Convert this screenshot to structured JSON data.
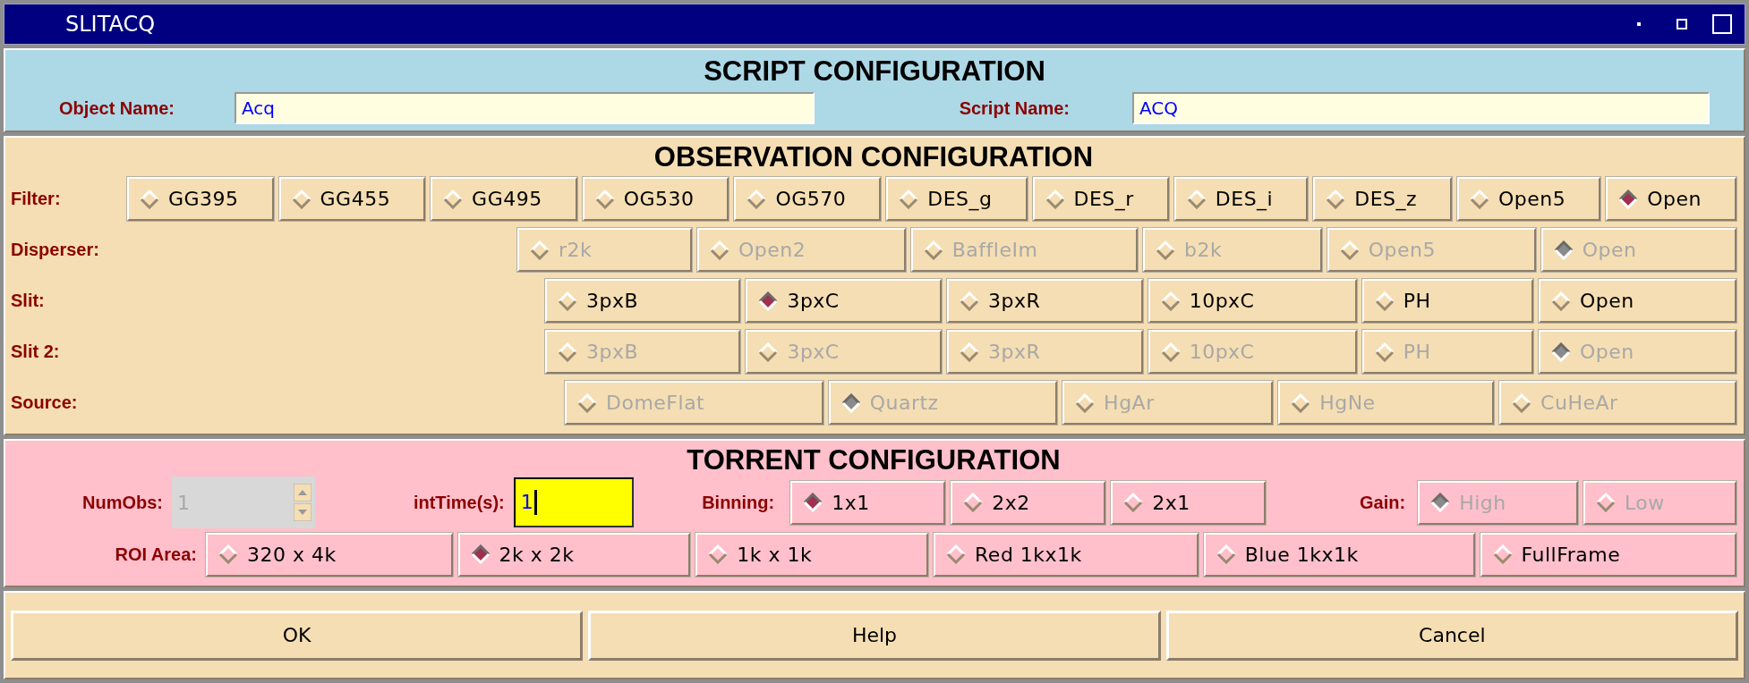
{
  "window": {
    "title": "SLITACQ"
  },
  "script": {
    "heading": "SCRIPT CONFIGURATION",
    "fields": [
      {
        "label": "Object Name:",
        "value": "Acq"
      },
      {
        "label": "Script Name:",
        "value": "ACQ"
      }
    ]
  },
  "observation": {
    "heading": "OBSERVATION CONFIGURATION",
    "rows": [
      {
        "label": "Filter:",
        "disabled": false,
        "options": [
          {
            "label": "GG395",
            "selected": false
          },
          {
            "label": "GG455",
            "selected": false
          },
          {
            "label": "GG495",
            "selected": false
          },
          {
            "label": "OG530",
            "selected": false
          },
          {
            "label": "OG570",
            "selected": false
          },
          {
            "label": "DES_g",
            "selected": false
          },
          {
            "label": "DES_r",
            "selected": false
          },
          {
            "label": "DES_i",
            "selected": false
          },
          {
            "label": "DES_z",
            "selected": false
          },
          {
            "label": "Open5",
            "selected": false
          },
          {
            "label": "Open",
            "selected": true
          }
        ]
      },
      {
        "label": "Disperser:",
        "disabled": true,
        "options": [
          {
            "label": "r2k",
            "selected": false
          },
          {
            "label": "Open2",
            "selected": false
          },
          {
            "label": "BaffleIm",
            "selected": false
          },
          {
            "label": "b2k",
            "selected": false
          },
          {
            "label": "Open5",
            "selected": false
          },
          {
            "label": "Open",
            "selected": true
          }
        ]
      },
      {
        "label": "Slit:",
        "disabled": false,
        "options": [
          {
            "label": "3pxB",
            "selected": false
          },
          {
            "label": "3pxC",
            "selected": true
          },
          {
            "label": "3pxR",
            "selected": false
          },
          {
            "label": "10pxC",
            "selected": false
          },
          {
            "label": "PH",
            "selected": false
          },
          {
            "label": "Open",
            "selected": false
          }
        ]
      },
      {
        "label": "Slit 2:",
        "disabled": true,
        "options": [
          {
            "label": "3pxB",
            "selected": false
          },
          {
            "label": "3pxC",
            "selected": false
          },
          {
            "label": "3pxR",
            "selected": false
          },
          {
            "label": "10pxC",
            "selected": false
          },
          {
            "label": "PH",
            "selected": false
          },
          {
            "label": "Open",
            "selected": true
          }
        ]
      },
      {
        "label": "Source:",
        "disabled": true,
        "options": [
          {
            "label": "DomeFlat",
            "selected": false
          },
          {
            "label": "Quartz",
            "selected": true
          },
          {
            "label": "HgAr",
            "selected": false
          },
          {
            "label": "HgNe",
            "selected": false
          },
          {
            "label": "CuHeAr",
            "selected": false
          }
        ]
      }
    ]
  },
  "torrent": {
    "heading": "TORRENT CONFIGURATION",
    "numobs": {
      "label": "NumObs:",
      "value": "1",
      "disabled": true
    },
    "inttime": {
      "label": "intTime(s):",
      "value": "1"
    },
    "binning": {
      "label": "Binning:",
      "disabled": false,
      "options": [
        {
          "label": "1x1",
          "selected": true
        },
        {
          "label": "2x2",
          "selected": false
        },
        {
          "label": "2x1",
          "selected": false
        }
      ]
    },
    "gain": {
      "label": "Gain:",
      "disabled": true,
      "options": [
        {
          "label": "High",
          "selected": true
        },
        {
          "label": "Low",
          "selected": false
        }
      ]
    },
    "roi": {
      "label": "ROI Area:",
      "disabled": false,
      "options": [
        {
          "label": "320 x 4k",
          "selected": false
        },
        {
          "label": "2k x 2k",
          "selected": true
        },
        {
          "label": "1k x 1k",
          "selected": false
        },
        {
          "label": "Red 1kx1k",
          "selected": false
        },
        {
          "label": "Blue 1kx1k",
          "selected": false
        },
        {
          "label": "FullFrame",
          "selected": false
        }
      ]
    }
  },
  "buttons": [
    "OK",
    "Help",
    "Cancel"
  ]
}
